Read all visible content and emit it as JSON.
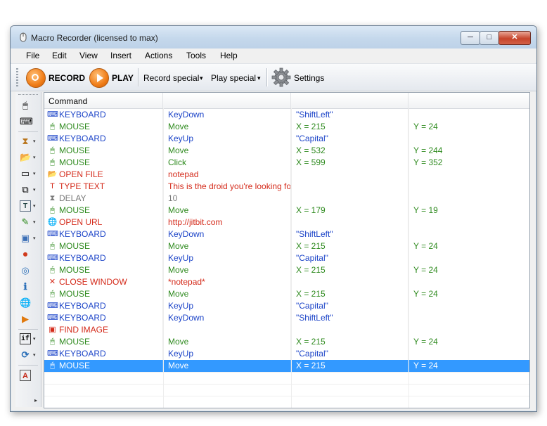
{
  "window": {
    "title": "Macro Recorder (licensed to max)"
  },
  "window_controls": {
    "minimize": "─",
    "maximize": "□",
    "close": "✕"
  },
  "menu": [
    "File",
    "Edit",
    "View",
    "Insert",
    "Actions",
    "Tools",
    "Help"
  ],
  "toolbar": {
    "record_label": "RECORD",
    "play_label": "PLAY",
    "record_special_label": "Record special",
    "play_special_label": "Play special",
    "settings_label": "Settings",
    "dropdown_arrow": "▾"
  },
  "sidebar": {
    "icons": [
      "mouse-icon",
      "keyboard-icon",
      "hourglass-icon",
      "open-file-icon",
      "window-icon",
      "copy-icon",
      "text-icon",
      "eyedropper-icon",
      "image-icon",
      "stop-icon",
      "globe-icon",
      "info-icon",
      "url-icon",
      "play-icon",
      "if-icon",
      "loop-icon",
      "font-icon"
    ],
    "glyphs": [
      "🖱",
      "⌨",
      "⧗",
      "📂",
      "▭",
      "⧉",
      "T",
      "✎",
      "▣",
      "⏺",
      "◎",
      "ℹ",
      "🌐",
      "▶",
      "if",
      "⟳",
      "A"
    ],
    "more_glyph": "▸"
  },
  "grid": {
    "columns": [
      "Command",
      "",
      "",
      ""
    ],
    "rows": [
      {
        "icon": "keyboard-icon",
        "glyph": "⌨",
        "command": "KEYBOARD",
        "action": "KeyDown",
        "p1": "\"ShiftLeft\"",
        "p2": "",
        "color": "#1c44c8"
      },
      {
        "icon": "mouse-icon",
        "glyph": "🖱",
        "command": "MOUSE",
        "action": "Move",
        "p1": "X = 215",
        "p2": "Y = 24",
        "color": "#2e8a1e"
      },
      {
        "icon": "keyboard-icon",
        "glyph": "⌨",
        "command": "KEYBOARD",
        "action": "KeyUp",
        "p1": "\"Capital\"",
        "p2": "",
        "color": "#1c44c8"
      },
      {
        "icon": "mouse-icon",
        "glyph": "🖱",
        "command": "MOUSE",
        "action": "Move",
        "p1": "X = 532",
        "p2": "Y = 244",
        "color": "#2e8a1e"
      },
      {
        "icon": "mouse-icon",
        "glyph": "🖱",
        "command": "MOUSE",
        "action": "Click",
        "p1": "X = 599",
        "p2": "Y = 352",
        "color": "#2e8a1e"
      },
      {
        "icon": "open-file-icon",
        "glyph": "📂",
        "command": "OPEN FILE",
        "action": "notepad",
        "p1": "",
        "p2": "",
        "color": "#d42a1a"
      },
      {
        "icon": "text-icon",
        "glyph": "T",
        "command": "TYPE TEXT",
        "action": "This is the droid you're looking for!",
        "p1": "",
        "p2": "",
        "color": "#d42a1a"
      },
      {
        "icon": "hourglass-icon",
        "glyph": "⧗",
        "command": "DELAY",
        "action": "10",
        "p1": "",
        "p2": "",
        "color": "#7a7a7a"
      },
      {
        "icon": "mouse-icon",
        "glyph": "🖱",
        "command": "MOUSE",
        "action": "Move",
        "p1": "X = 179",
        "p2": "Y = 19",
        "color": "#2e8a1e"
      },
      {
        "icon": "url-icon",
        "glyph": "🌐",
        "command": "OPEN URL",
        "action": "http://jitbit.com",
        "p1": "",
        "p2": "",
        "color": "#d42a1a"
      },
      {
        "icon": "keyboard-icon",
        "glyph": "⌨",
        "command": "KEYBOARD",
        "action": "KeyDown",
        "p1": "\"ShiftLeft\"",
        "p2": "",
        "color": "#1c44c8"
      },
      {
        "icon": "mouse-icon",
        "glyph": "🖱",
        "command": "MOUSE",
        "action": "Move",
        "p1": "X = 215",
        "p2": "Y = 24",
        "color": "#2e8a1e"
      },
      {
        "icon": "keyboard-icon",
        "glyph": "⌨",
        "command": "KEYBOARD",
        "action": "KeyUp",
        "p1": "\"Capital\"",
        "p2": "",
        "color": "#1c44c8"
      },
      {
        "icon": "mouse-icon",
        "glyph": "🖱",
        "command": "MOUSE",
        "action": "Move",
        "p1": "X = 215",
        "p2": "Y = 24",
        "color": "#2e8a1e"
      },
      {
        "icon": "close-window-icon",
        "glyph": "✕",
        "command": "CLOSE WINDOW",
        "action": "*notepad*",
        "p1": "",
        "p2": "",
        "color": "#d42a1a"
      },
      {
        "icon": "mouse-icon",
        "glyph": "🖱",
        "command": "MOUSE",
        "action": "Move",
        "p1": "X = 215",
        "p2": "Y = 24",
        "color": "#2e8a1e"
      },
      {
        "icon": "keyboard-icon",
        "glyph": "⌨",
        "command": "KEYBOARD",
        "action": "KeyUp",
        "p1": "\"Capital\"",
        "p2": "",
        "color": "#1c44c8"
      },
      {
        "icon": "keyboard-icon",
        "glyph": "⌨",
        "command": "KEYBOARD",
        "action": "KeyDown",
        "p1": "\"ShiftLeft\"",
        "p2": "",
        "color": "#1c44c8"
      },
      {
        "icon": "image-icon",
        "glyph": "▣",
        "command": "FIND IMAGE",
        "action": "",
        "p1": "",
        "p2": "",
        "color": "#d42a1a"
      },
      {
        "icon": "mouse-icon",
        "glyph": "🖱",
        "command": "MOUSE",
        "action": "Move",
        "p1": "X = 215",
        "p2": "Y = 24",
        "color": "#2e8a1e"
      },
      {
        "icon": "keyboard-icon",
        "glyph": "⌨",
        "command": "KEYBOARD",
        "action": "KeyUp",
        "p1": "\"Capital\"",
        "p2": "",
        "color": "#1c44c8"
      },
      {
        "icon": "mouse-icon",
        "glyph": "🖱",
        "command": "MOUSE",
        "action": "Move",
        "p1": "X = 215",
        "p2": "Y = 24",
        "color": "#2e8a1e",
        "selected": true
      }
    ]
  },
  "colors": {
    "keyboard": "#1c44c8",
    "mouse": "#2e8a1e",
    "action": "#d42a1a",
    "delay": "#7a7a7a",
    "selection": "#3399ff"
  }
}
